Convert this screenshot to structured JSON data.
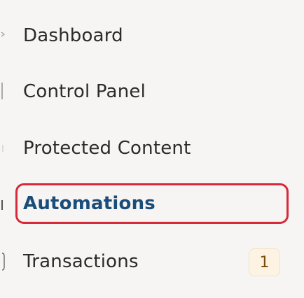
{
  "sidebar": {
    "items": [
      {
        "label": "Dashboard",
        "icon": "chevron-icon"
      },
      {
        "label": "Control Panel",
        "icon": "panel-icon"
      },
      {
        "label": "Protected Content",
        "icon": "lock-icon"
      },
      {
        "label": "Automations",
        "icon": "automation-icon",
        "selected": true
      },
      {
        "label": "Transactions",
        "icon": "transactions-icon",
        "badge": "1"
      }
    ]
  },
  "colors": {
    "background": "#f7f5f3",
    "text": "#2b2b2b",
    "selected_text": "#1a4d7a",
    "selected_border": "#d6293a",
    "badge_bg": "#fdf3e2",
    "badge_text": "#7a4a0a"
  }
}
